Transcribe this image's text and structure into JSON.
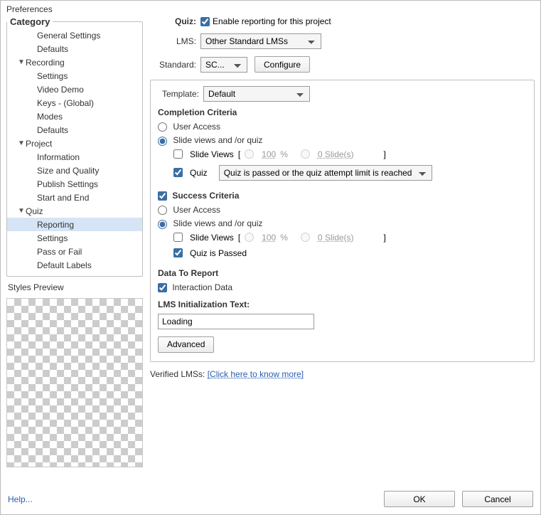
{
  "title": "Preferences",
  "category": {
    "legend": "Category",
    "items": [
      {
        "label": "General Settings",
        "level": 1,
        "expandable": false
      },
      {
        "label": "Defaults",
        "level": 1,
        "expandable": false
      },
      {
        "label": "Recording",
        "level": 0,
        "expandable": true,
        "expanded": true
      },
      {
        "label": "Settings",
        "level": 1,
        "expandable": false
      },
      {
        "label": "Video Demo",
        "level": 1,
        "expandable": false
      },
      {
        "label": "Keys - (Global)",
        "level": 1,
        "expandable": false
      },
      {
        "label": "Modes",
        "level": 1,
        "expandable": false
      },
      {
        "label": "Defaults",
        "level": 1,
        "expandable": false
      },
      {
        "label": "Project",
        "level": 0,
        "expandable": true,
        "expanded": true
      },
      {
        "label": "Information",
        "level": 1,
        "expandable": false
      },
      {
        "label": "Size and Quality",
        "level": 1,
        "expandable": false
      },
      {
        "label": "Publish Settings",
        "level": 1,
        "expandable": false
      },
      {
        "label": "Start and End",
        "level": 1,
        "expandable": false
      },
      {
        "label": "Quiz",
        "level": 0,
        "expandable": true,
        "expanded": true
      },
      {
        "label": "Reporting",
        "level": 1,
        "expandable": false,
        "selected": true
      },
      {
        "label": "Settings",
        "level": 1,
        "expandable": false
      },
      {
        "label": "Pass or Fail",
        "level": 1,
        "expandable": false
      },
      {
        "label": "Default Labels",
        "level": 1,
        "expandable": false
      }
    ]
  },
  "styles_preview": "Styles Preview",
  "main": {
    "quiz_label": "Quiz:",
    "enable_label": "Enable reporting for this project",
    "enable_checked": true,
    "lms_label": "LMS:",
    "lms_value": "Other Standard LMSs",
    "standard_label": "Standard:",
    "standard_value": "SC...",
    "configure_btn": "Configure",
    "template_label": "Template:",
    "template_value": "Default",
    "completion_title": "Completion Criteria",
    "cc_user_access": "User Access",
    "cc_slide_views_quiz": "Slide views and /or quiz",
    "cc_slide_views": "Slide Views",
    "cc_slide_pct": "100",
    "cc_slide_pct_unit": "%",
    "cc_slide_n": "0 Slide(s)",
    "cc_quiz_label": "Quiz",
    "cc_quiz_dropdown": "Quiz is passed or the quiz attempt limit is reached",
    "success_title": "Success Criteria",
    "sc_user_access": "User Access",
    "sc_slide_views_quiz": "Slide views and /or quiz",
    "sc_slide_views": "Slide Views",
    "sc_slide_pct": "100",
    "sc_slide_pct_unit": "%",
    "sc_slide_n": "0 Slide(s)",
    "sc_quiz_passed": "Quiz is Passed",
    "data_title": "Data To Report",
    "interaction_data": "Interaction Data",
    "lms_init_title": "LMS Initialization Text:",
    "lms_init_value": "Loading",
    "advanced_btn": "Advanced",
    "verified_label": "Verified LMSs:",
    "verified_link": "[Click here to know more]"
  },
  "footer": {
    "help": "Help...",
    "ok": "OK",
    "cancel": "Cancel"
  }
}
